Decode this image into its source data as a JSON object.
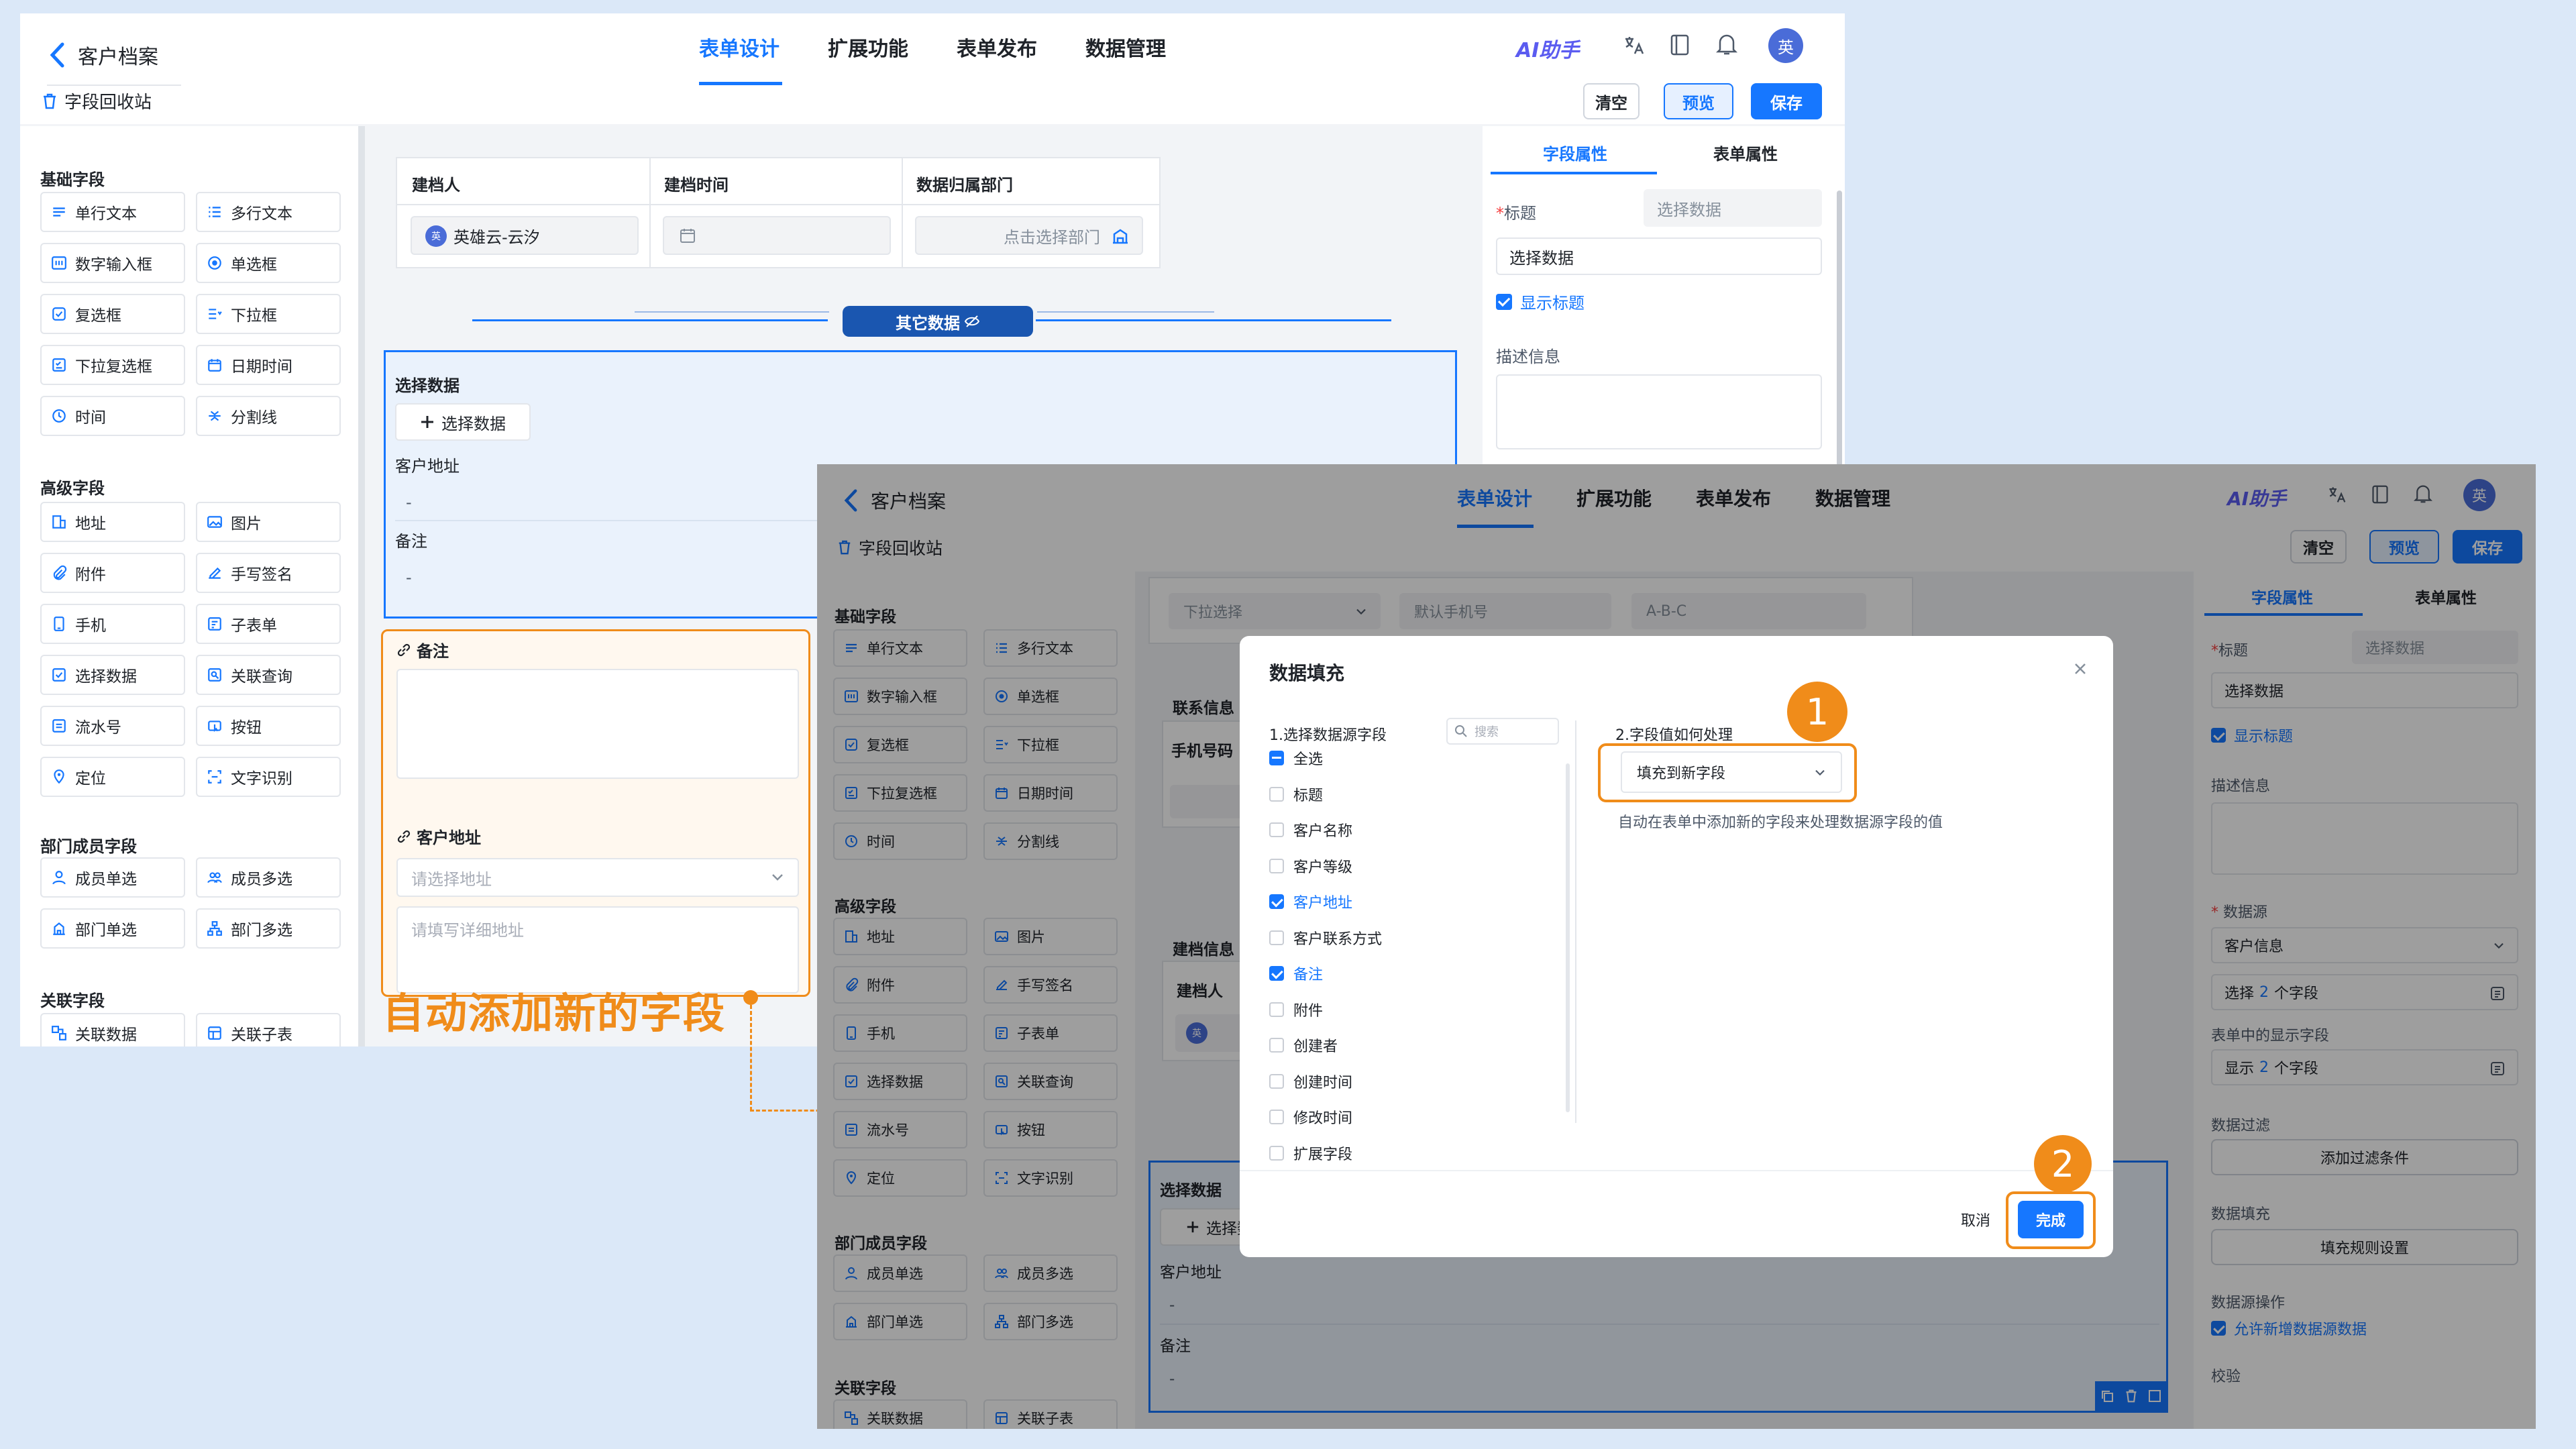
{
  "back_title": "客户档案",
  "recycle": "字段回收站",
  "tabs": [
    "表单设计",
    "扩展功能",
    "表单发布",
    "数据管理"
  ],
  "ai_label": "AI助手",
  "avatar_char": "英",
  "buttons": {
    "clear": "清空",
    "preview": "预览",
    "save": "保存"
  },
  "palette": {
    "basic_title": "基础字段",
    "basic": [
      "单行文本",
      "多行文本",
      "数字输入框",
      "单选框",
      "复选框",
      "下拉框",
      "下拉复选框",
      "日期时间",
      "时间",
      "分割线"
    ],
    "advanced_title": "高级字段",
    "advanced": [
      "地址",
      "图片",
      "附件",
      "手写签名",
      "手机",
      "子表单",
      "选择数据",
      "关联查询",
      "流水号",
      "按钮",
      "定位",
      "文字识别"
    ],
    "member_title": "部门成员字段",
    "member": [
      "成员单选",
      "成员多选",
      "部门单选",
      "部门多选"
    ],
    "relation_title": "关联字段",
    "relation": [
      "关联数据",
      "关联子表"
    ]
  },
  "bg_canvas": {
    "header_cols": [
      "建档人",
      "建档时间",
      "数据归属部门"
    ],
    "creator_value": "英雄云-云汐",
    "dept_placeholder": "点击选择部门",
    "divider_label": "其它数据",
    "select_block_title": "选择数据",
    "select_button": "选择数据",
    "field1": "客户地址",
    "field1_value": "-",
    "field2": "备注",
    "field2_value": "-",
    "note_title": "备注",
    "addr_title": "客户地址",
    "addr_placeholder": "请选择地址",
    "addr_detail_placeholder": "请填写详细地址",
    "annotation": "自动添加新的字段"
  },
  "bg_props": {
    "tab_field": "字段属性",
    "tab_form": "表单属性",
    "title_label": "标题",
    "title_hint": "选择数据",
    "title_value": "选择数据",
    "show_title": "显示标题",
    "desc_label": "描述信息"
  },
  "fg_canvas": {
    "row_fields": [
      "下拉选择",
      "默认手机号",
      "A-B-C"
    ],
    "contact_label": "联系信息",
    "phone_label": "手机号码",
    "archive_label": "建档信息",
    "creator_label": "建档人",
    "select_block_title": "选择数据",
    "select_button": "选择数据",
    "field1": "客户地址",
    "field1_value": "-",
    "field2": "备注",
    "field2_value": "-"
  },
  "fg_props": {
    "tab_field": "字段属性",
    "tab_form": "表单属性",
    "title_label": "标题",
    "title_hint": "选择数据",
    "title_value": "选择数据",
    "show_title": "显示标题",
    "desc_label": "描述信息",
    "source_label": "数据源",
    "source_value": "客户信息",
    "select_pre": "选择",
    "select_num": "2",
    "select_post": "个字段",
    "display_label": "表单中的显示字段",
    "display_pre": "显示",
    "display_num": "2",
    "display_post": "个字段",
    "filter_label": "数据过滤",
    "filter_button": "添加过滤条件",
    "fill_label": "数据填充",
    "fill_button": "填充规则设置",
    "op_label": "数据源操作",
    "op_check": "允许新增数据源数据",
    "cut_label": "校验"
  },
  "dialog": {
    "title": "数据填充",
    "left_title": "1.选择数据源字段",
    "search_placeholder": "搜索",
    "fields": [
      {
        "label": "全选",
        "state": "half"
      },
      {
        "label": "标题",
        "state": "off"
      },
      {
        "label": "客户名称",
        "state": "off"
      },
      {
        "label": "客户等级",
        "state": "off"
      },
      {
        "label": "客户地址",
        "state": "on"
      },
      {
        "label": "客户联系方式",
        "state": "off"
      },
      {
        "label": "备注",
        "state": "on"
      },
      {
        "label": "附件",
        "state": "off"
      },
      {
        "label": "创建者",
        "state": "off"
      },
      {
        "label": "创建时间",
        "state": "off"
      },
      {
        "label": "修改时间",
        "state": "off"
      },
      {
        "label": "扩展字段",
        "state": "off"
      }
    ],
    "right_title": "2.字段值如何处理",
    "select_value": "填充到新字段",
    "hint": "自动在表单中添加新的字段来处理数据源字段的值",
    "cancel": "取消",
    "done": "完成",
    "step1": "1",
    "step2": "2"
  },
  "colors": {
    "accent": "#1677ff",
    "orange": "#f08c1a",
    "bg": "#dbe8f8"
  }
}
